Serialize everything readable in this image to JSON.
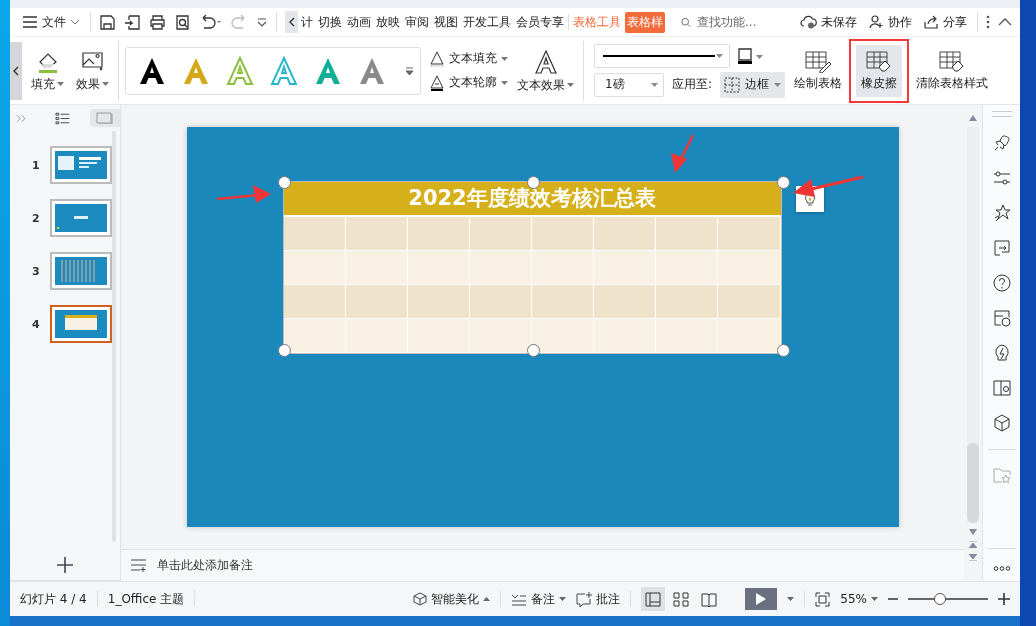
{
  "title_bar": {
    "file_menu": "文件",
    "tabs": [
      {
        "label": "计",
        "kind": "normal",
        "selected": false
      },
      {
        "label": "切换",
        "kind": "normal",
        "selected": false
      },
      {
        "label": "动画",
        "kind": "normal",
        "selected": false
      },
      {
        "label": "放映",
        "kind": "normal",
        "selected": false
      },
      {
        "label": "审阅",
        "kind": "normal",
        "selected": false
      },
      {
        "label": "视图",
        "kind": "normal",
        "selected": false
      },
      {
        "label": "开发工具",
        "kind": "normal",
        "selected": false
      },
      {
        "label": "会员专享",
        "kind": "normal",
        "selected": false
      },
      {
        "label": "表格工具",
        "kind": "context",
        "selected": false
      },
      {
        "label": "表格样",
        "kind": "context",
        "selected": true
      }
    ],
    "search": {
      "placeholder": "查找功能..."
    },
    "save_status": "未保存",
    "collaborate": "协作",
    "share": "分享"
  },
  "ribbon": {
    "fill": "填充",
    "effects": "效果",
    "text_styles": [
      {
        "kind": "solid",
        "color": "#000000"
      },
      {
        "kind": "solid",
        "color": "#d4a817"
      },
      {
        "kind": "outline",
        "color": "#8cbf3f"
      },
      {
        "kind": "outline",
        "color": "#2ab7c9"
      },
      {
        "kind": "solid",
        "color": "#0fae96"
      },
      {
        "kind": "solid",
        "color": "#8a8a8a"
      }
    ],
    "text_fill": "文本填充",
    "text_outline": "文本轮廓",
    "text_effect": "文本效果",
    "line_weight": "1磅",
    "apply_to_label": "应用至:",
    "apply_to": "边框",
    "tools": [
      {
        "label": "绘制表格",
        "kind": "draw",
        "selected": false
      },
      {
        "label": "橡皮擦",
        "kind": "eraser",
        "selected": true
      },
      {
        "label": "清除表格样式",
        "kind": "clear",
        "selected": false
      }
    ]
  },
  "slides": [
    {
      "number": "1",
      "kind": "cover",
      "selected": false
    },
    {
      "number": "2",
      "kind": "section",
      "selected": false
    },
    {
      "number": "3",
      "kind": "chart",
      "selected": false
    },
    {
      "number": "4",
      "kind": "table",
      "selected": true
    }
  ],
  "slide": {
    "title": "2022年度绩效考核汇总表"
  },
  "notes": {
    "placeholder": "单击此处添加备注"
  },
  "status_bar": {
    "slide_position": "幻灯片 4 / 4",
    "theme": "1_Office 主题",
    "beautify": "智能美化",
    "notes": "备注",
    "comments": "批注",
    "views": [
      {
        "kind": "normal",
        "selected": true
      },
      {
        "kind": "sorter",
        "selected": false
      },
      {
        "kind": "reading",
        "selected": false
      }
    ],
    "zoom": "55%",
    "zoom_slider": {
      "level": 0.4
    }
  }
}
